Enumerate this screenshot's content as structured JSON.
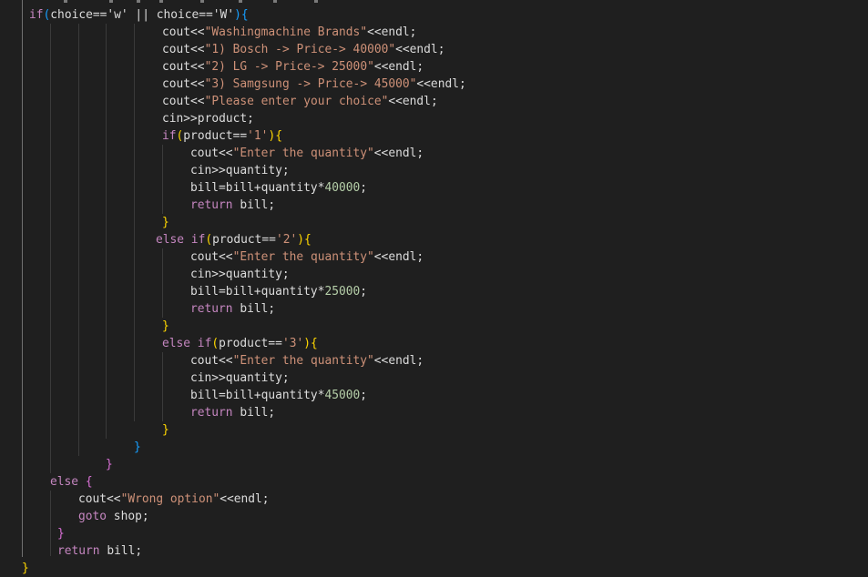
{
  "editor": {
    "theme": "dark",
    "colors": {
      "background": "#1f1f1f",
      "keyword": "#c586c0",
      "string": "#ce9178",
      "number": "#b5cea8",
      "text": "#dcdcdc",
      "bracket_level_1": "#ffd700",
      "bracket_level_2": "#da70d6",
      "bracket_level_3": "#179fff"
    },
    "lines": [
      [
        {
          "t": "if",
          "c": "t-kw"
        },
        {
          "t": "(",
          "c": "t-b3"
        },
        {
          "t": "choice=='w' || choice=='W'",
          "c": "t-var"
        },
        {
          "t": ")",
          "c": "t-b3"
        },
        {
          "t": "{",
          "c": "t-b3"
        }
      ],
      [
        {
          "t": "cout<<",
          "c": "t-var"
        },
        {
          "t": "\"Washingmachine Brands\"",
          "c": "t-str"
        },
        {
          "t": "<<endl;",
          "c": "t-var"
        }
      ],
      [
        {
          "t": "cout<<",
          "c": "t-var"
        },
        {
          "t": "\"1) Bosch -> Price-> 40000\"",
          "c": "t-str"
        },
        {
          "t": "<<endl;",
          "c": "t-var"
        }
      ],
      [
        {
          "t": "cout<<",
          "c": "t-var"
        },
        {
          "t": "\"2) LG -> Price-> 25000\"",
          "c": "t-str"
        },
        {
          "t": "<<endl;",
          "c": "t-var"
        }
      ],
      [
        {
          "t": "cout<<",
          "c": "t-var"
        },
        {
          "t": "\"3) Samgsung -> Price-> 45000\"",
          "c": "t-str"
        },
        {
          "t": "<<endl;",
          "c": "t-var"
        }
      ],
      [
        {
          "t": "cout<<",
          "c": "t-var"
        },
        {
          "t": "\"Please enter your choice\"",
          "c": "t-str"
        },
        {
          "t": "<<endl;",
          "c": "t-var"
        }
      ],
      [
        {
          "t": "cin>>product;",
          "c": "t-var"
        }
      ],
      [
        {
          "t": "if",
          "c": "t-kw"
        },
        {
          "t": "(",
          "c": "t-b1"
        },
        {
          "t": "product==",
          "c": "t-var"
        },
        {
          "t": "'1'",
          "c": "t-str"
        },
        {
          "t": ")",
          "c": "t-b1"
        },
        {
          "t": "{",
          "c": "t-b1"
        }
      ],
      [
        {
          "t": "cout<<",
          "c": "t-var"
        },
        {
          "t": "\"Enter the quantity\"",
          "c": "t-str"
        },
        {
          "t": "<<endl;",
          "c": "t-var"
        }
      ],
      [
        {
          "t": "cin>>quantity;",
          "c": "t-var"
        }
      ],
      [
        {
          "t": "bill=bill+quantity*",
          "c": "t-var"
        },
        {
          "t": "40000",
          "c": "t-num"
        },
        {
          "t": ";",
          "c": "t-var"
        }
      ],
      [
        {
          "t": "return",
          "c": "t-kw"
        },
        {
          "t": " bill;",
          "c": "t-var"
        }
      ],
      [
        {
          "t": "}",
          "c": "t-b1"
        }
      ],
      [
        {
          "t": "else if",
          "c": "t-kw"
        },
        {
          "t": "(",
          "c": "t-b1"
        },
        {
          "t": "product==",
          "c": "t-var"
        },
        {
          "t": "'2'",
          "c": "t-str"
        },
        {
          "t": ")",
          "c": "t-b1"
        },
        {
          "t": "{",
          "c": "t-b1"
        }
      ],
      [
        {
          "t": "cout<<",
          "c": "t-var"
        },
        {
          "t": "\"Enter the quantity\"",
          "c": "t-str"
        },
        {
          "t": "<<endl;",
          "c": "t-var"
        }
      ],
      [
        {
          "t": "cin>>quantity;",
          "c": "t-var"
        }
      ],
      [
        {
          "t": "bill=bill+quantity*",
          "c": "t-var"
        },
        {
          "t": "25000",
          "c": "t-num"
        },
        {
          "t": ";",
          "c": "t-var"
        }
      ],
      [
        {
          "t": "return",
          "c": "t-kw"
        },
        {
          "t": " bill;",
          "c": "t-var"
        }
      ],
      [
        {
          "t": "}",
          "c": "t-b1"
        }
      ],
      [
        {
          "t": "else if",
          "c": "t-kw"
        },
        {
          "t": "(",
          "c": "t-b1"
        },
        {
          "t": "product==",
          "c": "t-var"
        },
        {
          "t": "'3'",
          "c": "t-str"
        },
        {
          "t": ")",
          "c": "t-b1"
        },
        {
          "t": "{",
          "c": "t-b1"
        }
      ],
      [
        {
          "t": "cout<<",
          "c": "t-var"
        },
        {
          "t": "\"Enter the quantity\"",
          "c": "t-str"
        },
        {
          "t": "<<endl;",
          "c": "t-var"
        }
      ],
      [
        {
          "t": "cin>>quantity;",
          "c": "t-var"
        }
      ],
      [
        {
          "t": "bill=bill+quantity*",
          "c": "t-var"
        },
        {
          "t": "45000",
          "c": "t-num"
        },
        {
          "t": ";",
          "c": "t-var"
        }
      ],
      [
        {
          "t": "return",
          "c": "t-kw"
        },
        {
          "t": " bill;",
          "c": "t-var"
        }
      ],
      [
        {
          "t": "}",
          "c": "t-b1"
        }
      ],
      [
        {
          "t": "}",
          "c": "t-b3"
        }
      ],
      [
        {
          "t": "}",
          "c": "t-b2"
        }
      ],
      [
        {
          "t": "else",
          "c": "t-kw"
        },
        {
          "t": " ",
          "c": "t-var"
        },
        {
          "t": "{",
          "c": "t-b2"
        }
      ],
      [
        {
          "t": "cout<<",
          "c": "t-var"
        },
        {
          "t": "\"Wrong option\"",
          "c": "t-str"
        },
        {
          "t": "<<endl;",
          "c": "t-var"
        }
      ],
      [
        {
          "t": "goto",
          "c": "t-kw"
        },
        {
          "t": " shop;",
          "c": "t-var"
        }
      ],
      [
        {
          "t": "}",
          "c": "t-b2"
        }
      ],
      [
        {
          "t": "return",
          "c": "t-kw"
        },
        {
          "t": " bill;",
          "c": "t-var"
        }
      ],
      [
        {
          "t": "}",
          "c": "t-b1"
        }
      ]
    ]
  }
}
